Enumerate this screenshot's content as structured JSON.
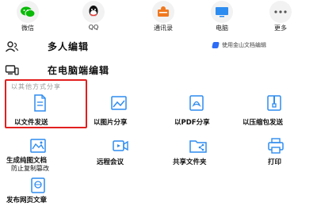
{
  "share_targets": [
    {
      "label": "微信",
      "icon": "wechat-icon",
      "color": "#09bb07"
    },
    {
      "label": "QQ",
      "icon": "qq-icon",
      "color": "#111111"
    },
    {
      "label": "通讯录",
      "icon": "contacts-icon",
      "color": "#f0781e"
    },
    {
      "label": "电脑",
      "icon": "computer-icon",
      "color": "#2d8cf0"
    },
    {
      "label": "更多",
      "icon": "more-icon",
      "color": "#555555"
    }
  ],
  "multi_edit": {
    "label": "多人编辑",
    "icon": "people-icon"
  },
  "pc_edit": {
    "label": "在电脑端编辑",
    "icon": "pc-edit-icon"
  },
  "wps_tip": {
    "label": "使用金山文档编辑",
    "icon": "wps-logo-icon"
  },
  "section_title": "以其他方式分享",
  "options": [
    {
      "label": "以文件发送",
      "icon": "file-icon"
    },
    {
      "label": "以图片分享",
      "icon": "image-icon"
    },
    {
      "label": "以PDF分享",
      "icon": "pdf-icon"
    },
    {
      "label": "以压缩包发送",
      "icon": "zip-icon"
    },
    {
      "label": "生成纯图文档",
      "sub": "防止复制篡改",
      "icon": "image-doc-icon"
    },
    {
      "label": "远程会议",
      "icon": "video-meeting-icon"
    },
    {
      "label": "共享文件夹",
      "icon": "shared-folder-icon"
    },
    {
      "label": "打印",
      "icon": "printer-icon"
    },
    {
      "label": "发布网页文章",
      "icon": "web-article-icon"
    }
  ],
  "colors": {
    "accent": "#2d8cf0",
    "highlight": "#e21f1f"
  }
}
